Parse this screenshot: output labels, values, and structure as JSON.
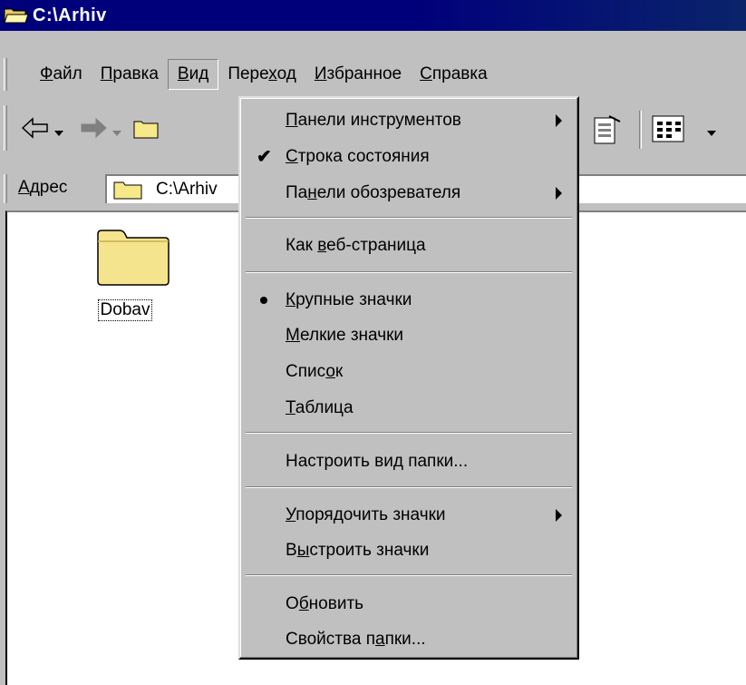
{
  "window": {
    "title": "C:\\Arhiv"
  },
  "menubar": {
    "items": [
      {
        "label": "Файл"
      },
      {
        "label": "Правка"
      },
      {
        "label": "Вид"
      },
      {
        "label": "Переход"
      },
      {
        "label": "Избранное"
      },
      {
        "label": "Справка"
      }
    ],
    "active": "Вид"
  },
  "toolbar": {
    "buttons": [
      "back-icon",
      "forward-icon",
      "up-folder-icon",
      "properties-icon",
      "view-options-icon"
    ]
  },
  "address": {
    "label": "Адрес",
    "value": "C:\\Arhiv"
  },
  "content": {
    "items": [
      {
        "label": "Dobav",
        "icon": "folder-icon"
      }
    ]
  },
  "view_menu": {
    "items": [
      {
        "label": "Панели инструментов",
        "submenu": true
      },
      {
        "label": "Строка состояния",
        "checked": true
      },
      {
        "label": "Панели обозревателя",
        "submenu": true
      },
      {
        "label": "Как веб-страница"
      },
      {
        "label": "Крупные значки",
        "selected": true
      },
      {
        "label": "Мелкие значки"
      },
      {
        "label": "Список"
      },
      {
        "label": "Таблица"
      },
      {
        "label": "Настроить вид папки..."
      },
      {
        "label": "Упорядочить значки",
        "submenu": true
      },
      {
        "label": "Выстроить значки"
      },
      {
        "label": "Обновить"
      },
      {
        "label": "Свойства папки..."
      }
    ]
  },
  "colors": {
    "titlebar": "#00007b",
    "face": "#c0c0c0",
    "folder": "#f7e88a"
  }
}
